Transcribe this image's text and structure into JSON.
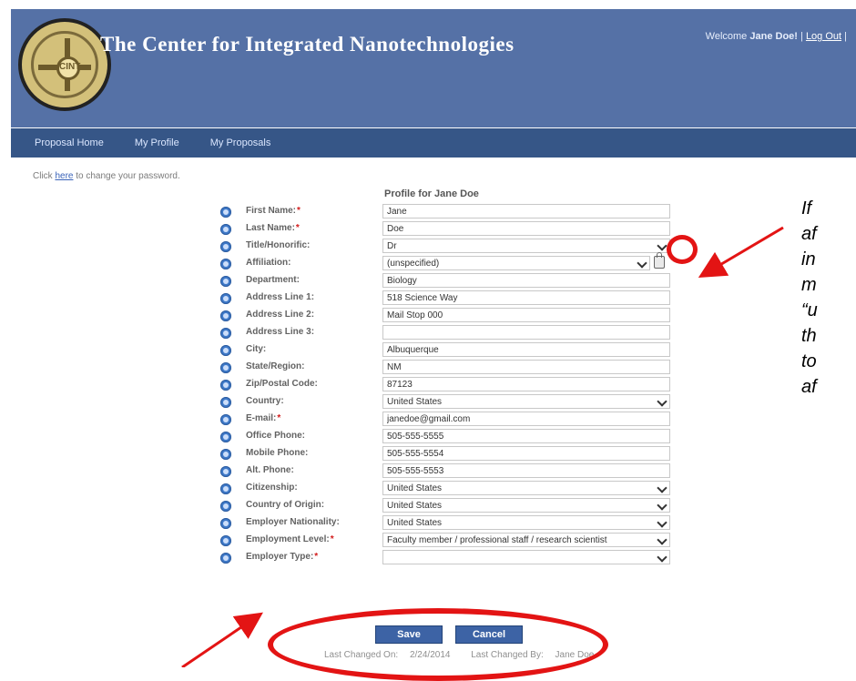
{
  "header": {
    "title": "The Center for Integrated Nanotechnologies",
    "welcome_prefix": "Welcome",
    "user_name": "Jane Doe!",
    "logout": "Log Out",
    "logo_text": "CINT"
  },
  "nav": {
    "items": [
      "Proposal Home",
      "My Profile",
      "My Proposals"
    ]
  },
  "change_password": {
    "prefix": "Click",
    "link": "here",
    "suffix": "to change your password."
  },
  "form": {
    "title": "Profile for Jane Doe",
    "fields": [
      {
        "label": "First Name:",
        "required": true,
        "type": "input",
        "value": "Jane"
      },
      {
        "label": "Last Name:",
        "required": true,
        "type": "input",
        "value": "Doe"
      },
      {
        "label": "Title/Honorific:",
        "required": false,
        "type": "select",
        "value": "Dr"
      },
      {
        "label": "Affiliation:",
        "required": false,
        "type": "select",
        "value": "(unspecified)"
      },
      {
        "label": "Department:",
        "required": false,
        "type": "input",
        "value": "Biology"
      },
      {
        "label": "Address Line 1:",
        "required": false,
        "type": "input",
        "value": "518 Science Way"
      },
      {
        "label": "Address Line 2:",
        "required": false,
        "type": "input",
        "value": "Mail Stop 000"
      },
      {
        "label": "Address Line 3:",
        "required": false,
        "type": "input",
        "value": ""
      },
      {
        "label": "City:",
        "required": false,
        "type": "input",
        "value": "Albuquerque"
      },
      {
        "label": "State/Region:",
        "required": false,
        "type": "input",
        "value": "NM"
      },
      {
        "label": "Zip/Postal Code:",
        "required": false,
        "type": "input",
        "value": "87123"
      },
      {
        "label": "Country:",
        "required": false,
        "type": "select",
        "value": "United States"
      },
      {
        "label": "E-mail:",
        "required": true,
        "type": "input",
        "value": "janedoe@gmail.com"
      },
      {
        "label": "Office Phone:",
        "required": false,
        "type": "input",
        "value": "505-555-5555"
      },
      {
        "label": "Mobile Phone:",
        "required": false,
        "type": "input",
        "value": "505-555-5554"
      },
      {
        "label": "Alt. Phone:",
        "required": false,
        "type": "input",
        "value": "505-555-5553"
      },
      {
        "label": "Citizenship:",
        "required": false,
        "type": "select",
        "value": "United States"
      },
      {
        "label": "Country of Origin:",
        "required": false,
        "type": "select",
        "value": "United States"
      },
      {
        "label": "Employer Nationality:",
        "required": false,
        "type": "select",
        "value": "United States"
      },
      {
        "label": "Employment Level:",
        "required": true,
        "type": "select",
        "value": "Faculty member / professional staff / research scientist"
      },
      {
        "label": "Employer Type:",
        "required": true,
        "type": "select",
        "value": ""
      }
    ],
    "buttons": {
      "save": "Save",
      "cancel": "Cancel"
    },
    "last_changed_on_label": "Last Changed On:",
    "last_changed_on": "2/24/2014",
    "last_changed_by_label": "Last Changed By:",
    "last_changed_by": "Jane Doe"
  },
  "annotation": {
    "text_lines": [
      "If",
      "af",
      "in",
      "m",
      "“u",
      "th",
      "to",
      "af"
    ],
    "color": "#e31414"
  },
  "colors": {
    "header_bg": "#5571a6",
    "nav_bg": "#365687",
    "button_bg": "#3d63a5",
    "required": "#d21b1b"
  }
}
